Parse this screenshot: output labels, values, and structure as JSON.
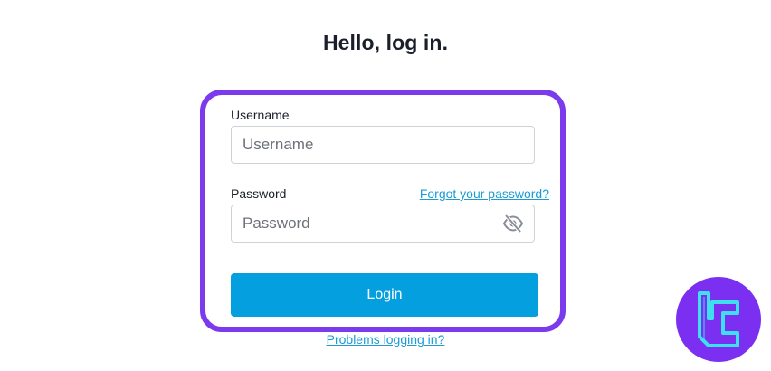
{
  "page": {
    "title": "Hello, log in."
  },
  "form": {
    "username": {
      "label": "Username",
      "placeholder": "Username",
      "value": ""
    },
    "password": {
      "label": "Password",
      "placeholder": "Password",
      "value": "",
      "visibility_icon": "eye-slash-icon"
    },
    "forgot_password_link": "Forgot your password?",
    "login_button": "Login"
  },
  "footer": {
    "problems_link": "Problems logging in?"
  },
  "colors": {
    "highlight_border": "#7c3aed",
    "primary_button": "#049fdf",
    "link": "#1a9cd3",
    "logo_bg": "#7b2ff0",
    "logo_glyph": "#3ee0f0"
  }
}
